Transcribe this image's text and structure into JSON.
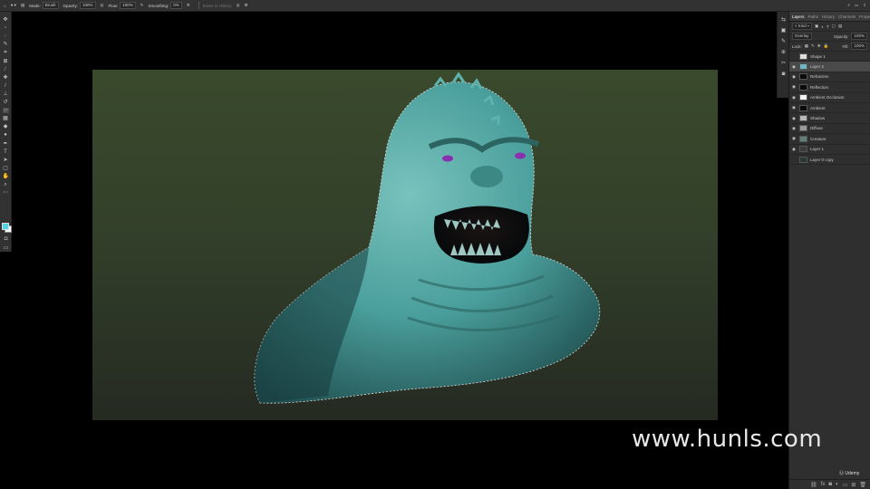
{
  "options_bar": {
    "tool_icon": "brush-icon",
    "mode_label": "Mode:",
    "mode_value": "Brush",
    "opacity_label": "Opacity:",
    "opacity_value": "100%",
    "flow_label": "Flow:",
    "flow_value": "100%",
    "smoothing_label": "Smoothing:",
    "smoothing_value": "0%",
    "erase_history_label": "Erase to History"
  },
  "tools": [
    "move-tool-icon",
    "artboard-icon",
    "lasso-tool-icon",
    "quick-select-icon",
    "crop-tool-icon",
    "frame-tool-icon",
    "eyedropper-icon",
    "healing-brush-icon",
    "brush-tool-icon",
    "clone-stamp-icon",
    "history-brush-icon",
    "eraser-icon",
    "gradient-tool-icon",
    "blur-tool-icon",
    "dodge-tool-icon",
    "pen-tool-icon",
    "type-tool-icon",
    "path-select-icon",
    "shape-tool-icon",
    "hand-tool-icon",
    "zoom-tool-icon",
    "more-tools-icon"
  ],
  "swatches": {
    "foreground": "#4fd4e8",
    "background": "#ffffff"
  },
  "canvas": {
    "subject_color": "#4a9f9c",
    "background_top": "#3a4a2c",
    "background_bottom": "#252a22"
  },
  "layers_panel": {
    "tabs": [
      "Layers",
      "Paths",
      "History",
      "Channels",
      "Properties"
    ],
    "filter_label": "Kind",
    "blend_mode": "Overlay",
    "opacity_label": "Opacity:",
    "opacity_value": "100%",
    "lock_label": "Lock:",
    "fill_label": "Fill:",
    "fill_value": "100%",
    "layers": [
      {
        "name": "Shape 1",
        "visible": false,
        "selected": false,
        "thumb": "#dddddd"
      },
      {
        "name": "Layer 2",
        "visible": true,
        "selected": true,
        "thumb": "#6fb7c2"
      },
      {
        "name": "Refraction",
        "visible": true,
        "selected": false,
        "thumb": "#0a0a0a"
      },
      {
        "name": "Reflection",
        "visible": true,
        "selected": false,
        "thumb": "#0a0a0a"
      },
      {
        "name": "Ambient Occlusion",
        "visible": true,
        "selected": false,
        "thumb": "#f2f2f2"
      },
      {
        "name": "Ambient",
        "visible": true,
        "selected": false,
        "thumb": "#0a0a0a"
      },
      {
        "name": "Shadow",
        "visible": true,
        "selected": false,
        "thumb": "#b8b8b8"
      },
      {
        "name": "Diffuse",
        "visible": true,
        "selected": false,
        "thumb": "#9a9a9a"
      },
      {
        "name": "Creature",
        "visible": true,
        "selected": false,
        "thumb": "#5f7f7a"
      },
      {
        "name": "Layer 1",
        "visible": true,
        "selected": false,
        "thumb": "#3b3b3b"
      },
      {
        "name": "Layer 0 copy",
        "visible": false,
        "selected": false,
        "thumb": "#2a3a30"
      }
    ]
  },
  "watermark": {
    "text": "www.hunls.com"
  },
  "udemy": {
    "text": "Udemy"
  }
}
